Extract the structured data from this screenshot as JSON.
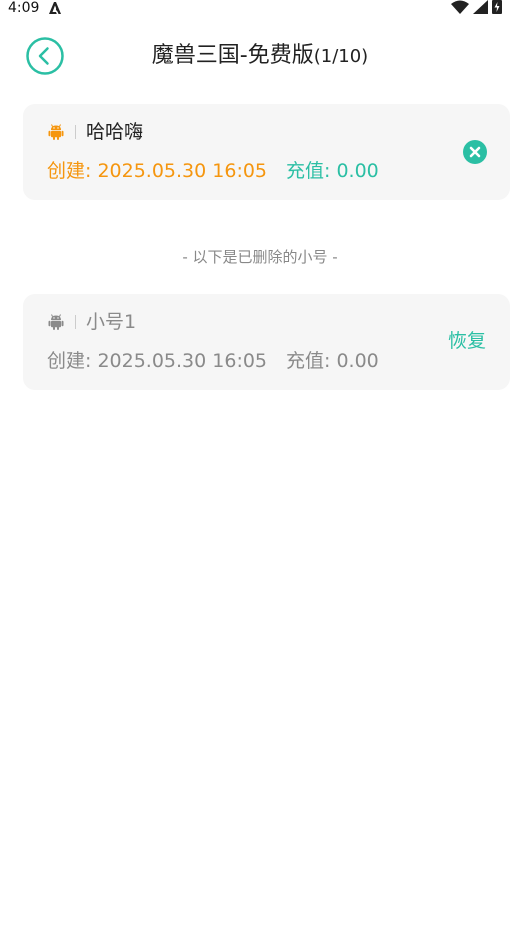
{
  "status_bar": {
    "time": "4:09",
    "icons": [
      "accessibility-a-icon",
      "wifi-icon",
      "signal-icon",
      "battery-charging-icon"
    ]
  },
  "header": {
    "title": "魔兽三国-免费版",
    "count": "(1/10)",
    "back_icon": "chevron-left-circle-icon"
  },
  "active_accounts": [
    {
      "platform_icon": "android-icon",
      "name": "哈哈嗨",
      "created": "创建: 2025.05.30 16:05",
      "recharge": "充值: 0.00",
      "action_icon": "close-circle-icon"
    }
  ],
  "deleted_separator": "- 以下是已删除的小号 -",
  "deleted_accounts": [
    {
      "platform_icon": "android-icon",
      "name": "小号1",
      "created": "创建: 2025.05.30 16:05",
      "recharge": "充值: 0.00",
      "action_label": "恢复"
    }
  ],
  "colors": {
    "accent_teal": "#2bbfa4",
    "active_orange": "#f5960f",
    "deleted_gray": "#8a8a8a",
    "card_bg": "#f6f6f6"
  }
}
